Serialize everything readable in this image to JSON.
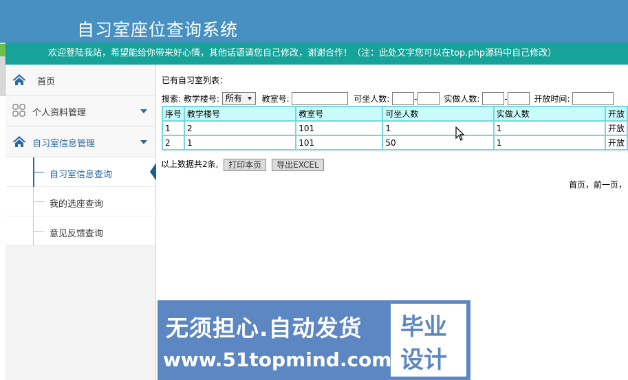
{
  "header": {
    "title": "自习室座位查询系统"
  },
  "marquee": {
    "text": "欢迎登陆我站，希望能给你带来好心情，其他话语请您自己修改，谢谢合作！（注：此处文字您可以在top.php源码中自己修改）"
  },
  "sidebar": {
    "home": "首页",
    "profile": "个人资料管理",
    "room_info": "自习室信息管理",
    "sub_items": [
      "自习室信息查询",
      "我的选座查询",
      "意见反馈查询"
    ]
  },
  "content": {
    "list_title": "已有自习室列表：",
    "search": {
      "label": "搜索:",
      "building_label": "教学楼号:",
      "building_selected": "所有",
      "room_label": "教室号:",
      "capacity_label": "可坐人数:",
      "dash": "-",
      "actual_label": "实做人数:",
      "open_time_label": "开放时间:"
    },
    "table": {
      "headers": [
        "序号",
        "教学楼号",
        "教室号",
        "可坐人数",
        "实做人数",
        "开放"
      ],
      "rows": [
        [
          "1",
          "2",
          "101",
          "1",
          "1",
          "开放"
        ],
        [
          "2",
          "1",
          "101",
          "50",
          "1",
          "开放"
        ]
      ]
    },
    "summary": "以上数据共2条,",
    "print_button": "打印本页",
    "export_button": "导出EXCEL",
    "pager": "首页，前一页，"
  },
  "banner": {
    "line1": "无须担心.自动发货",
    "line2": "www.51topmind.com",
    "logo_line1": "毕业",
    "logo_line2": "设计"
  },
  "colors": {
    "header": "#4790c1",
    "marquee": "#17a39a",
    "accent": "#2a6aa0",
    "table_border": "#74d7e0",
    "table_header": "#c9fbfb",
    "banner": "#5d87c2"
  }
}
